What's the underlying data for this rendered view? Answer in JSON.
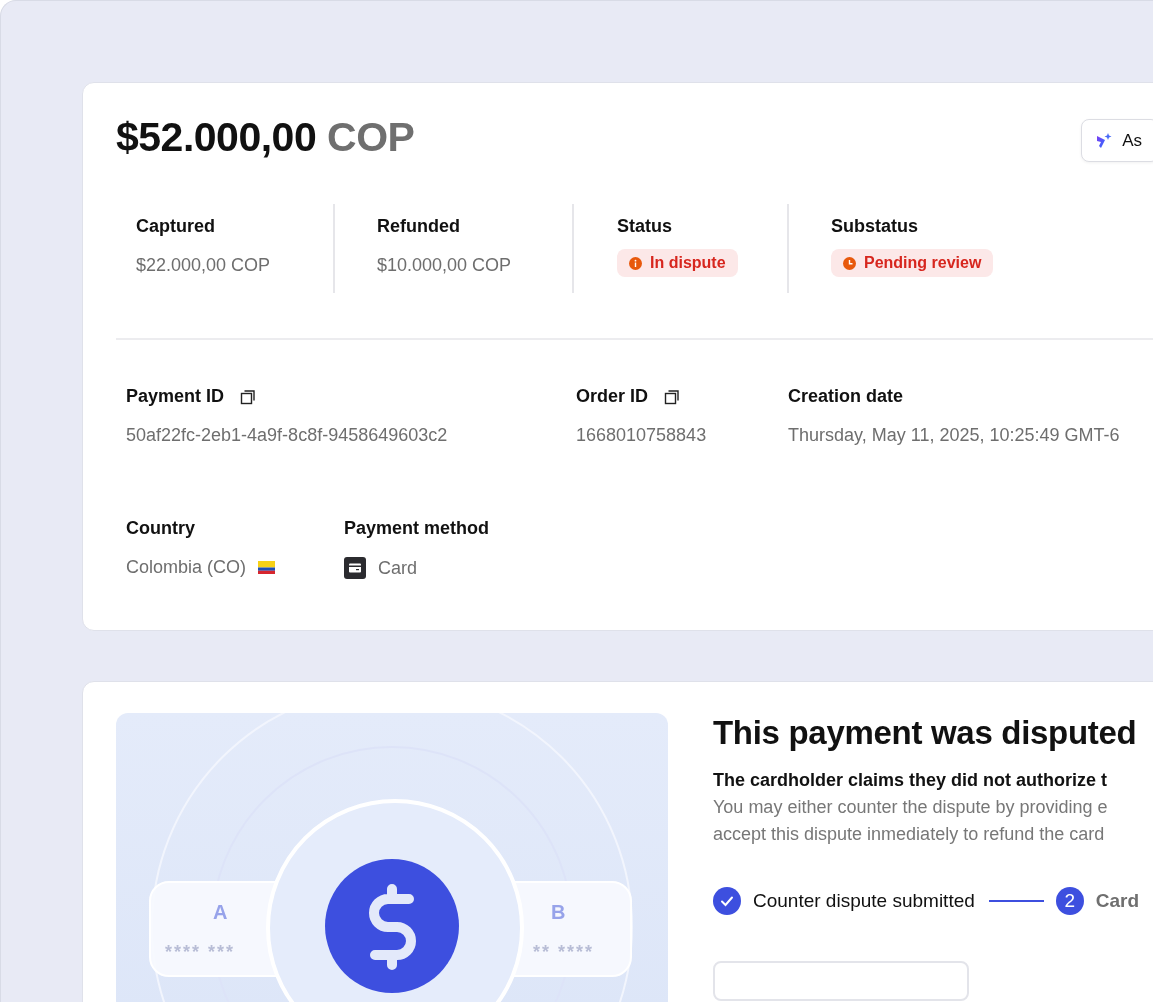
{
  "amount": {
    "value": "$52.000,00",
    "currency": "COP"
  },
  "ask_button": {
    "label": "As"
  },
  "summary": [
    {
      "label": "Captured",
      "kind": "text",
      "value": "$22.000,00 COP"
    },
    {
      "label": "Refunded",
      "kind": "text",
      "value": "$10.000,00 COP"
    },
    {
      "label": "Status",
      "kind": "alert",
      "value": "In dispute"
    },
    {
      "label": "Substatus",
      "kind": "pending",
      "value": "Pending review"
    }
  ],
  "details": [
    {
      "label": "Payment ID",
      "copyable": true,
      "value": "50af22fc-2eb1-4a9f-8c8f-9458649603c2",
      "kind": "text"
    },
    {
      "label": "Order ID",
      "copyable": true,
      "value": "1668010758843",
      "kind": "text"
    },
    {
      "label": "Creation date",
      "copyable": false,
      "value": "Thursday, May 11, 2025, 10:25:49 GMT-6",
      "kind": "text"
    },
    {
      "label": "Country",
      "copyable": false,
      "value": "Colombia (CO)",
      "kind": "country"
    },
    {
      "label": "Payment method",
      "copyable": false,
      "value": "Card",
      "kind": "method"
    }
  ],
  "illustration": {
    "cards": [
      {
        "letter": "A",
        "number": "**** ***"
      },
      {
        "letter": "B",
        "number": "** ****"
      }
    ]
  },
  "dispute": {
    "title": "This payment was disputed",
    "reason": "The cardholder claims they did not authorize t",
    "description": [
      "You may either counter the dispute by providing e",
      "accept this dispute inmediately to refund the card"
    ],
    "steps": [
      {
        "label": "Counter dispute submitted",
        "done": true
      },
      {
        "label": "Card",
        "done": false,
        "number": "2"
      }
    ]
  }
}
